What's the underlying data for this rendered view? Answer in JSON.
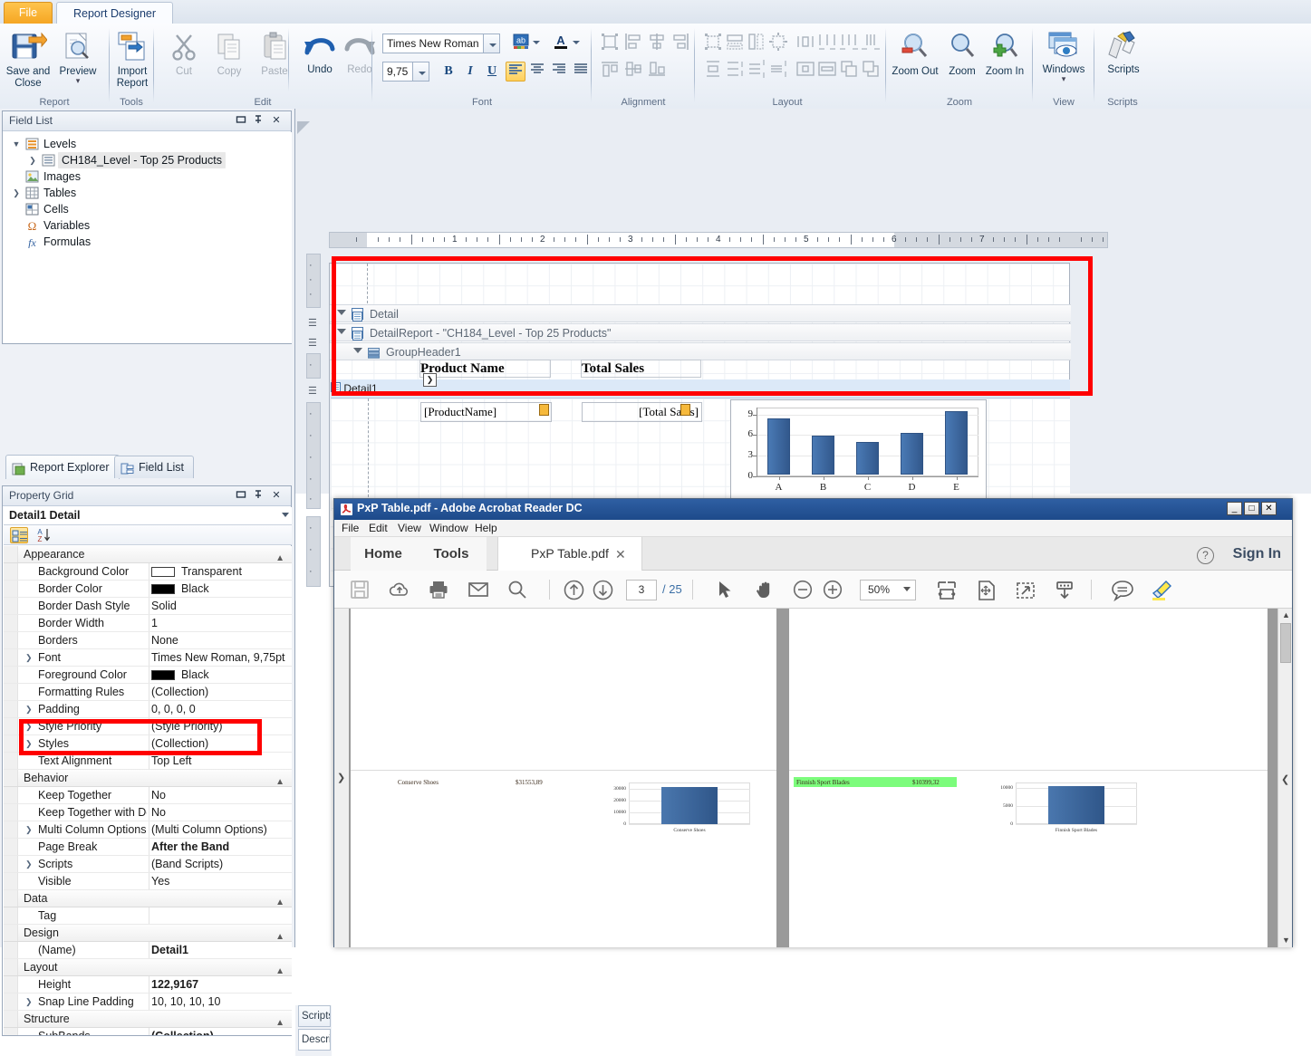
{
  "ribbon": {
    "tabs": [
      {
        "label": "File",
        "name": "tab-file"
      },
      {
        "label": "Report Designer",
        "name": "tab-report-designer"
      }
    ],
    "groups": [
      {
        "label": "Report"
      },
      {
        "label": "Tools"
      },
      {
        "label": "Edit"
      },
      {
        "label": "Font"
      },
      {
        "label": "Alignment"
      },
      {
        "label": "Layout"
      },
      {
        "label": "Zoom"
      },
      {
        "label": "View"
      },
      {
        "label": "Scripts"
      }
    ],
    "buttons": {
      "save_and_close": "Save and\nClose",
      "save_and_close_l1": "Save and",
      "save_and_close_l2": "Close",
      "preview": "Preview",
      "import_report_l1": "Import",
      "import_report_l2": "Report",
      "cut": "Cut",
      "copy": "Copy",
      "paste": "Paste",
      "undo": "Undo",
      "redo": "Redo",
      "zoom_out": "Zoom Out",
      "zoom": "Zoom",
      "zoom_in": "Zoom In",
      "windows": "Windows",
      "scripts": "Scripts"
    },
    "font": {
      "family_value": "Times New Roman",
      "size_value": "9,75",
      "bold": "B",
      "italic": "I",
      "underline": "U"
    }
  },
  "field_list": {
    "title": "Field List",
    "items": [
      {
        "label": "Levels",
        "icon": "levels-icon",
        "expanded": true,
        "indent": 0
      },
      {
        "label": "CH184_Level - Top 25 Products",
        "icon": "level-icon",
        "expanded": false,
        "indent": 1,
        "selected": true
      },
      {
        "label": "Images",
        "icon": "images-icon",
        "indent": 0
      },
      {
        "label": "Tables",
        "icon": "tables-icon",
        "expanded": false,
        "indent": 0
      },
      {
        "label": "Cells",
        "icon": "cells-icon",
        "indent": 0
      },
      {
        "label": "Variables",
        "icon": "omega-icon",
        "indent": 0
      },
      {
        "label": "Formulas",
        "icon": "fx-icon",
        "indent": 0
      }
    ]
  },
  "panel_tabs": [
    {
      "label": "Report Explorer",
      "active": true
    },
    {
      "label": "Field List",
      "active": false
    }
  ],
  "property_grid": {
    "title": "Property Grid",
    "selected_object": "Detail1  Detail",
    "rows": [
      {
        "type": "category",
        "name": "Appearance"
      },
      {
        "type": "prop",
        "name": "Background Color",
        "value": "Transparent",
        "swatch": "#ffffff"
      },
      {
        "type": "prop",
        "name": "Border Color",
        "value": "Black",
        "swatch": "#000000"
      },
      {
        "type": "prop",
        "name": "Border Dash Style",
        "value": "Solid"
      },
      {
        "type": "prop",
        "name": "Border Width",
        "value": "1"
      },
      {
        "type": "prop",
        "name": "Borders",
        "value": "None"
      },
      {
        "type": "prop",
        "name": "Font",
        "value": "Times New Roman, 9,75pt",
        "expandable": true
      },
      {
        "type": "prop",
        "name": "Foreground Color",
        "value": "Black",
        "swatch": "#000000"
      },
      {
        "type": "prop",
        "name": "Formatting Rules",
        "value": "(Collection)"
      },
      {
        "type": "prop",
        "name": "Padding",
        "value": "0, 0, 0, 0",
        "expandable": true
      },
      {
        "type": "prop",
        "name": "Style Priority",
        "value": "(Style Priority)",
        "expandable": true
      },
      {
        "type": "prop",
        "name": "Styles",
        "value": "(Collection)",
        "expandable": true
      },
      {
        "type": "prop",
        "name": "Text Alignment",
        "value": "Top Left"
      },
      {
        "type": "category",
        "name": "Behavior"
      },
      {
        "type": "prop",
        "name": "Keep Together",
        "value": "No"
      },
      {
        "type": "prop",
        "name": "Keep Together with Detai",
        "value": "No"
      },
      {
        "type": "prop",
        "name": "Multi Column Options",
        "value": "(Multi Column Options)",
        "expandable": true
      },
      {
        "type": "prop",
        "name": "Page Break",
        "value": "After the Band",
        "bold": true
      },
      {
        "type": "prop",
        "name": "Scripts",
        "value": "(Band Scripts)",
        "expandable": true
      },
      {
        "type": "prop",
        "name": "Visible",
        "value": "Yes"
      },
      {
        "type": "category",
        "name": "Data"
      },
      {
        "type": "prop",
        "name": "Tag",
        "value": ""
      },
      {
        "type": "category",
        "name": "Design"
      },
      {
        "type": "prop",
        "name": "(Name)",
        "value": "Detail1",
        "bold": true
      },
      {
        "type": "category",
        "name": "Layout"
      },
      {
        "type": "prop",
        "name": "Height",
        "value": "122,9167",
        "bold": true
      },
      {
        "type": "prop",
        "name": "Snap Line Padding",
        "value": "10, 10, 10, 10",
        "expandable": true
      },
      {
        "type": "category",
        "name": "Structure"
      },
      {
        "type": "prop",
        "name": "SubBands",
        "value": "(Collection)",
        "bold": true
      }
    ]
  },
  "script_tabs": [
    {
      "label": "Scripts"
    },
    {
      "label": "Descri"
    }
  ],
  "designer": {
    "ruler_numbers": [
      "1",
      "2",
      "3",
      "4",
      "5",
      "6",
      "7"
    ],
    "bands": [
      {
        "label": "Detail",
        "icon": "band-icon",
        "indent": 0
      },
      {
        "label": "DetailReport - \"CH184_Level - Top 25 Products\"",
        "icon": "report-icon",
        "indent": 1
      },
      {
        "label": "GroupHeader1",
        "icon": "groupheader-icon",
        "indent": 2
      },
      {
        "label": "Detail1",
        "icon": "band-icon",
        "indent": 2,
        "selected": true
      }
    ],
    "group_header_fields": [
      "Product Name",
      "Total Sales"
    ],
    "detail_fields": [
      "[ProductName]",
      "[Total Sales]"
    ]
  },
  "chart_data": {
    "type": "bar",
    "title": "",
    "categories": [
      "A",
      "B",
      "C",
      "D",
      "E"
    ],
    "values": [
      8.1,
      5.6,
      4.8,
      6.0,
      9.2
    ],
    "yticks": [
      "0",
      "3",
      "6",
      "9"
    ],
    "ylim": [
      0,
      10
    ],
    "xlabel": "",
    "ylabel": "",
    "grid": true,
    "legend": "none",
    "series_color": "#3a649c"
  },
  "acrobat": {
    "window_title": "PxP Table.pdf - Adobe Acrobat Reader DC",
    "window_buttons": [
      "_",
      "□",
      "✕"
    ],
    "menu": [
      "File",
      "Edit",
      "View",
      "Window",
      "Help"
    ],
    "tabs": [
      {
        "label": "Home"
      },
      {
        "label": "Tools"
      },
      {
        "label": "PxP Table.pdf",
        "closable": true
      }
    ],
    "sign_in": "Sign In",
    "toolbar": {
      "page_current": "3",
      "page_total": "/ 25",
      "zoom_value": "50%"
    },
    "pdf_pages": [
      {
        "product": "Conserve Shoes",
        "amount": "$31553,89",
        "highlighted": false,
        "chart": {
          "type": "bar",
          "categories": [
            "Conserve Shoes"
          ],
          "values": [
            31553.89
          ],
          "yticks": [
            "0",
            "10000",
            "20000",
            "30000"
          ],
          "ylim": [
            0,
            35000
          ]
        }
      },
      {
        "product": "Finnish Sport Blades",
        "amount": "$10399,32",
        "highlighted": true,
        "highlight_color": "#7cfc7c",
        "chart": {
          "type": "bar",
          "categories": [
            "Finnish Sport Blades"
          ],
          "values": [
            10399.32
          ],
          "yticks": [
            "0",
            "5000",
            "10000"
          ],
          "ylim": [
            0,
            11500
          ]
        }
      }
    ]
  }
}
